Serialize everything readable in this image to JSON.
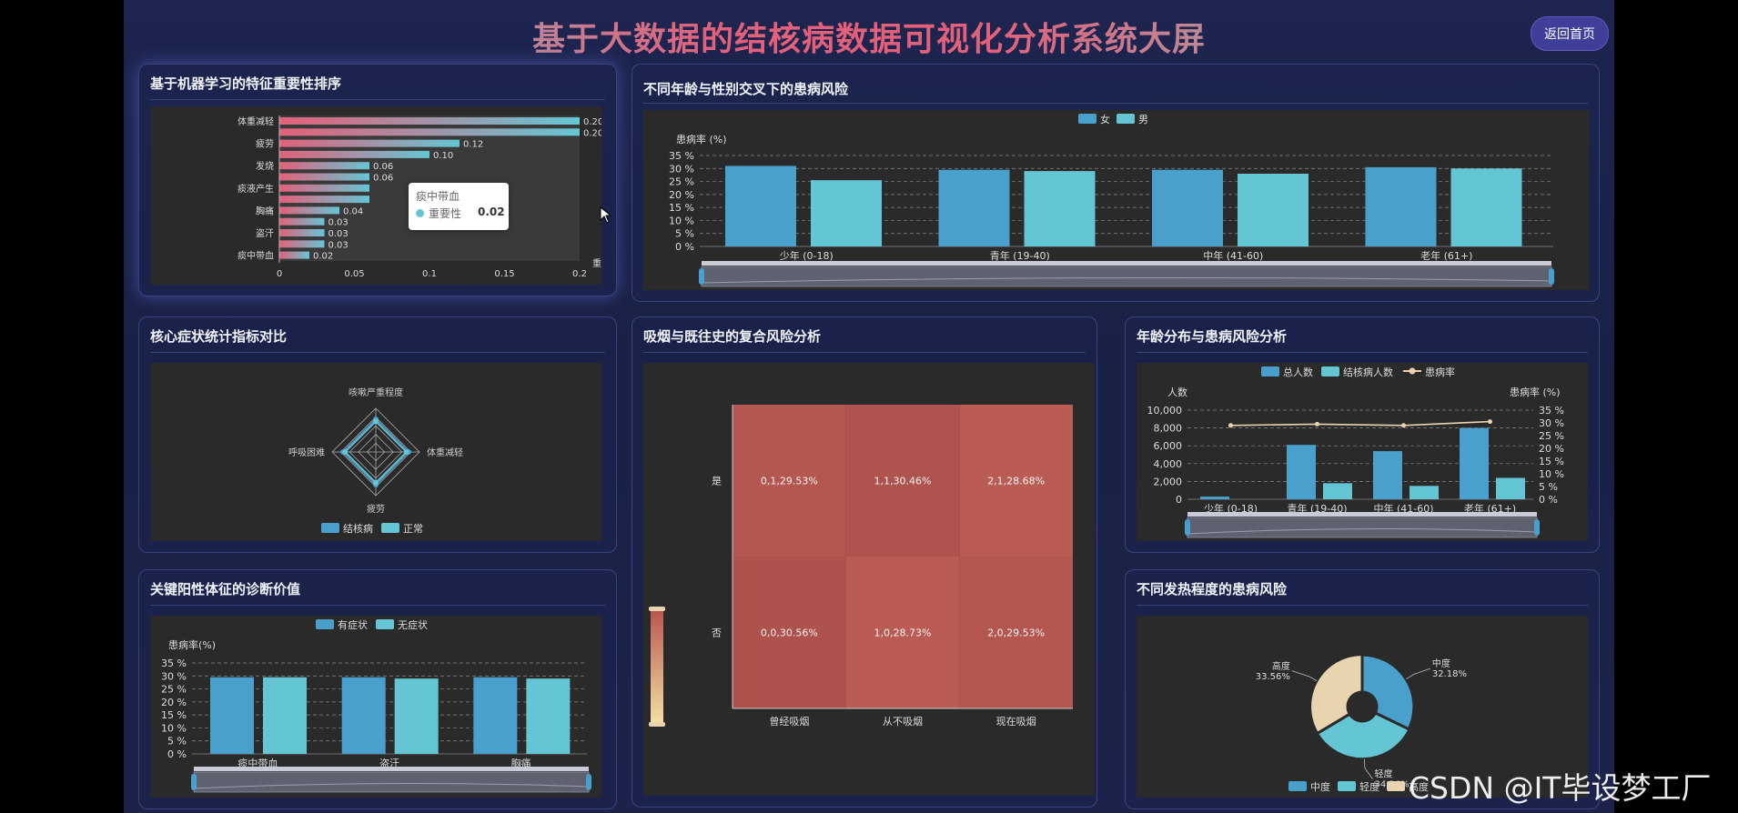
{
  "header": {
    "title": "基于大数据的结核病数据可视化分析系统大屏",
    "home_label": "返回首页"
  },
  "colors": {
    "teal": "#64c6d4",
    "blue": "#4aa0cc",
    "red": "#e3607a",
    "cream": "#e9d4b0"
  },
  "panels": {
    "feature": {
      "title": "基于机器学习的特征重要性排序",
      "tooltip": {
        "title": "痰中带血",
        "label": "重要性",
        "value": "0.02"
      }
    },
    "agegender": {
      "title": "不同年龄与性别交叉下的患病风险"
    },
    "radar": {
      "title": "核心症状统计指标对比"
    },
    "heatmap": {
      "title": "吸烟与既往史的复合风险分析"
    },
    "agedist": {
      "title": "年龄分布与患病风险分析"
    },
    "signs": {
      "title": "关键阳性体征的诊断价值"
    },
    "fever": {
      "title": "不同发热程度的患病风险"
    }
  },
  "watermark": "CSDN @IT毕设梦工厂",
  "chart_data": [
    {
      "id": "feature",
      "type": "bar",
      "orientation": "horizontal",
      "categories": [
        "体重减轻",
        "",
        "疲劳",
        "",
        "发烧",
        "",
        "痰液产生",
        "",
        "胸痛",
        "",
        "盗汗",
        "",
        "痰中带血"
      ],
      "values": [
        0.2,
        0.2,
        0.12,
        0.1,
        0.06,
        0.06,
        0.06,
        0.06,
        0.04,
        0.03,
        0.03,
        0.03,
        0.02
      ],
      "value_labels": [
        "0.20",
        "0.20",
        "0.12",
        "0.10",
        "0.06",
        "0.06",
        "",
        "",
        "0.04",
        "0.03",
        "0.03",
        "0.03",
        "0.02"
      ],
      "xticks": [
        "0",
        "0.05",
        "0.1",
        "0.15",
        "0.2"
      ],
      "xlabel": "重",
      "xlim": [
        0,
        0.2
      ]
    },
    {
      "id": "agegender",
      "type": "bar",
      "categories": [
        "少年 (0-18)",
        "青年 (19-40)",
        "中年 (41-60)",
        "老年 (61+)"
      ],
      "series": [
        {
          "name": "女",
          "values": [
            31,
            29.5,
            29.5,
            30.5
          ]
        },
        {
          "name": "男",
          "values": [
            25.5,
            29,
            28,
            30
          ]
        }
      ],
      "ylabel": "患病率 (%)",
      "yticks": [
        "0 %",
        "5 %",
        "10 %",
        "15 %",
        "20 %",
        "25 %",
        "30 %",
        "35 %"
      ],
      "ylim": [
        0,
        35
      ]
    },
    {
      "id": "radar",
      "type": "radar",
      "indicators": [
        "咳嗽严重程度",
        "体重减轻",
        "疲劳",
        "呼吸困难"
      ],
      "series": [
        {
          "name": "结核病",
          "values": [
            0.75,
            0.75,
            0.75,
            0.75
          ]
        },
        {
          "name": "正常",
          "values": [
            0.7,
            0.7,
            0.7,
            0.7
          ]
        }
      ]
    },
    {
      "id": "heatmap",
      "type": "heatmap",
      "x_categories": [
        "曾经吸烟",
        "从不吸烟",
        "现在吸烟"
      ],
      "y_categories": [
        "是",
        "否"
      ],
      "cells": [
        {
          "label": "0,1,29.53%",
          "value": 29.53
        },
        {
          "label": "1,1,30.46%",
          "value": 30.46
        },
        {
          "label": "2,1,28.68%",
          "value": 28.68
        },
        {
          "label": "0,0,30.56%",
          "value": 30.56
        },
        {
          "label": "1,0,28.73%",
          "value": 28.73
        },
        {
          "label": "2,0,29.53%",
          "value": 29.53
        }
      ]
    },
    {
      "id": "agedist",
      "type": "bar+line",
      "categories": [
        "少年 (0-18)",
        "青年 (19-40)",
        "中年 (41-60)",
        "老年 (61+)"
      ],
      "series": [
        {
          "name": "总人数",
          "values": [
            300,
            6100,
            5400,
            8000
          ]
        },
        {
          "name": "结核病人数",
          "values": [
            0,
            1800,
            1500,
            2400
          ]
        },
        {
          "name": "患病率",
          "values": [
            29,
            29.5,
            29,
            30.5
          ],
          "axis": "right"
        }
      ],
      "ylabel_left": "人数",
      "ylabel_right": "患病率 (%)",
      "yticks_left": [
        "0",
        "2,000",
        "4,000",
        "6,000",
        "8,000",
        "10,000"
      ],
      "yticks_right": [
        "0 %",
        "5 %",
        "10 %",
        "15 %",
        "20 %",
        "25 %",
        "30 %",
        "35 %"
      ],
      "ylim_left": [
        0,
        10000
      ],
      "ylim_right": [
        0,
        35
      ]
    },
    {
      "id": "signs",
      "type": "bar",
      "categories": [
        "痰中带血",
        "盗汗",
        "胸痛"
      ],
      "series": [
        {
          "name": "有症状",
          "values": [
            29.5,
            29.5,
            29.5
          ]
        },
        {
          "name": "无症状",
          "values": [
            29.5,
            29,
            29
          ]
        }
      ],
      "ylabel": "患病率(%)",
      "yticks": [
        "0 %",
        "5 %",
        "10 %",
        "15 %",
        "20 %",
        "25 %",
        "30 %",
        "35 %"
      ],
      "ylim": [
        0,
        35
      ]
    },
    {
      "id": "fever",
      "type": "pie",
      "slices": [
        {
          "name": "中度",
          "value": 32.18,
          "label": "32.18%"
        },
        {
          "name": "轻度",
          "value": 34.26,
          "label": "34.26%"
        },
        {
          "name": "高度",
          "value": 33.56,
          "label": "33.56%"
        }
      ]
    }
  ]
}
